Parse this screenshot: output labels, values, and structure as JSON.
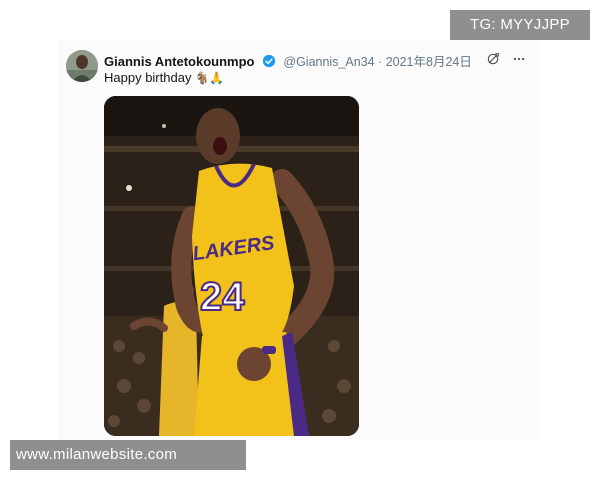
{
  "tweet": {
    "display_name": "Giannis Antetokounmpo",
    "handle_and_date": "@Giannis_An34 · 2021年8月24日",
    "text": "Happy birthday",
    "emojis": "🐐🙏",
    "image_alt_jersey_team": "LAKERS",
    "image_alt_jersey_number": "24"
  },
  "icons": {
    "verified": "verified-badge-icon",
    "action_refresh": "refresh-icon",
    "action_more": "more-icon"
  },
  "watermarks": {
    "top_right": "TG: MYYJJPP",
    "bottom_left": "www.milanwebsite.com"
  },
  "colors": {
    "verified_blue": "#1d9bf0",
    "jersey_gold": "#f2c21b",
    "jersey_purple": "#4b2a85",
    "watermark_bg": "#8f8f8f"
  }
}
